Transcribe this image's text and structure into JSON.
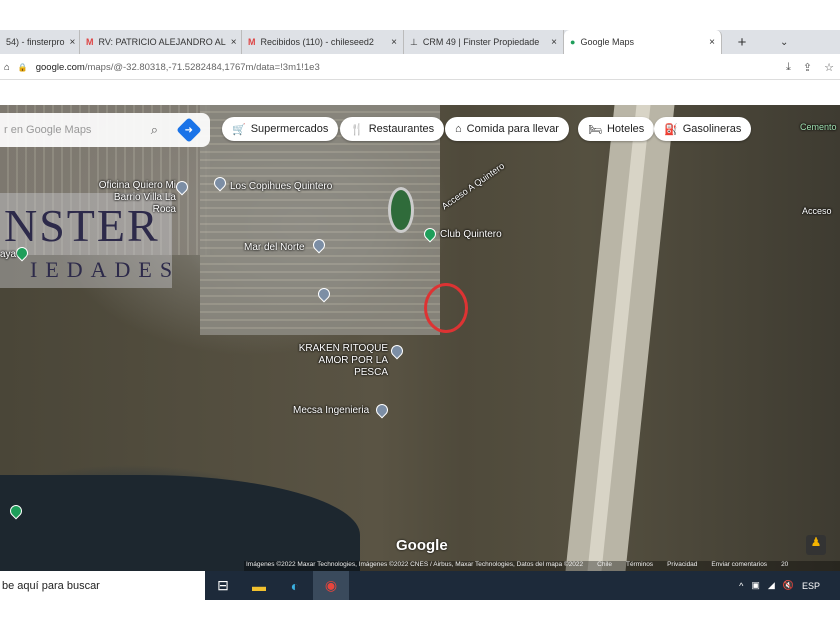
{
  "browser": {
    "tabs": [
      {
        "label": "54) - finsterpro",
        "icon": "tab-icon"
      },
      {
        "label": "RV: PATRICIO ALEJANDRO AL",
        "icon": "gmail-icon"
      },
      {
        "label": "Recibidos (110) - chileseed2",
        "icon": "gmail-icon"
      },
      {
        "label": "CRM 49 | Finster Propiedade",
        "icon": "crm-icon"
      },
      {
        "label": "Google Maps",
        "icon": "maps-pin-icon",
        "active": true
      }
    ],
    "new_tab": "+",
    "close": "×",
    "url_domain": "google.com",
    "url_path": "/maps/@-32.80318,-71.5282484,1767m/data=!3m1!1e3"
  },
  "map": {
    "search_placeholder": "r en Google Maps",
    "chips": [
      {
        "label": "Supermercados",
        "icon": "cart-icon",
        "glyph": "🛒"
      },
      {
        "label": "Restaurantes",
        "icon": "fork-knife-icon",
        "glyph": "🍴"
      },
      {
        "label": "Comida para llevar",
        "icon": "takeout-icon",
        "glyph": "🥡"
      },
      {
        "label": "Hoteles",
        "icon": "bed-icon",
        "glyph": "🛏"
      },
      {
        "label": "Gasolineras",
        "icon": "gas-icon",
        "glyph": "⛽"
      }
    ],
    "places": {
      "oficina": "Oficina Quiero Mi Barrio Villa La Roca",
      "copihues": "Los Copihues Quintero",
      "mar_del_norte": "Mar del Norte",
      "club": "Club Quintero",
      "acceso": "Acceso A Quintero",
      "acceso2": "Acceso",
      "cemento": "Cemento",
      "kraken": "KRAKEN RITOQUE AMOR POR LA PESCA",
      "mecsa": "Mecsa Ingenieria",
      "playa": "aya"
    },
    "watermark": {
      "line1": "NSTER",
      "line2": "IEDADES"
    },
    "google_logo": "Google",
    "attribution": [
      "Imágenes ©2022 Maxar Technologies, Imágenes ©2022 CNES / Airbus, Maxar Technologies, Datos del mapa ©2022",
      "Chile",
      "Términos",
      "Privacidad",
      "Enviar comentarios",
      "20"
    ],
    "marker_color": "#dd3333"
  },
  "taskbar": {
    "search_placeholder": "be aquí para buscar",
    "language": "ESP"
  }
}
